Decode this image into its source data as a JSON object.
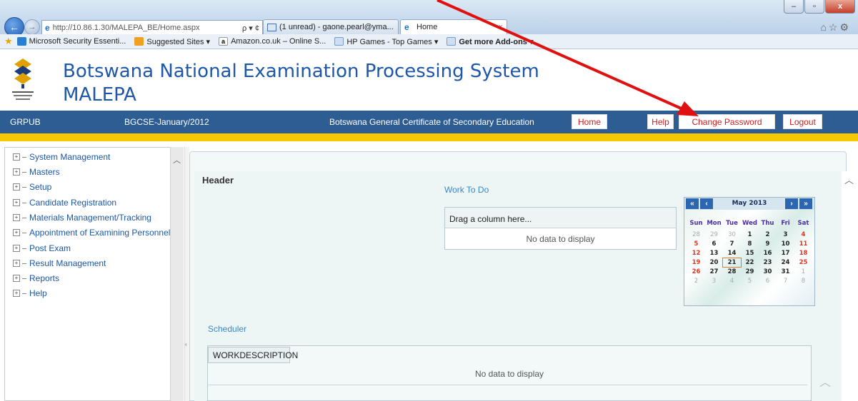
{
  "browser": {
    "url": "http://10.86.1.30/MALEPA_BE/Home.aspx",
    "search_glyph": "ρ ▾ ¢",
    "tabs": [
      {
        "label": "(1 unread) - gaone.pearl@yma..."
      },
      {
        "label": "Home",
        "close": "×"
      }
    ],
    "window_controls": {
      "minimize": "–",
      "maximize": "▫",
      "close": "x"
    },
    "right_icons": "⌂☆⚙",
    "favorites": [
      {
        "label": "Microsoft Security Essenti..."
      },
      {
        "label": "Suggested Sites ▾"
      },
      {
        "label": "Amazon.co.uk – Online S..."
      },
      {
        "label": "HP Games - Top Games ▾"
      },
      {
        "label": "Get more Add-ons ▾"
      }
    ]
  },
  "header": {
    "title_line1": "Botswana National Examination Processing System",
    "title_line2": "MALEPA"
  },
  "topbar": {
    "user": "GRPUB",
    "session": "BGCSE-January/2012",
    "certificate": "Botswana General Certificate of Secondary Education",
    "buttons": {
      "home": "Home",
      "help": "Help",
      "change_password": "Change Password",
      "logout": "Logout"
    }
  },
  "tree": {
    "items": [
      {
        "label": "System Management"
      },
      {
        "label": "Masters"
      },
      {
        "label": "Setup"
      },
      {
        "label": "Candidate Registration"
      },
      {
        "label": "Materials Management/Tracking"
      },
      {
        "label": "Appointment of Examining Personnel"
      },
      {
        "label": "Post Exam"
      },
      {
        "label": "Result Management"
      },
      {
        "label": "Reports"
      },
      {
        "label": "Help"
      }
    ]
  },
  "main": {
    "header_label": "Header",
    "work_to_do": {
      "title": "Work To Do",
      "group_prompt": "Drag a column here...",
      "empty": "No data to display"
    },
    "calendar": {
      "month": "May 2013",
      "nav": {
        "prev_year": "«",
        "prev": "‹",
        "next": "›",
        "next_year": "»"
      },
      "weekdays": [
        "Sun",
        "Mon",
        "Tue",
        "Wed",
        "Thu",
        "Fri",
        "Sat"
      ],
      "weeks": [
        [
          "28",
          "29",
          "30",
          "1",
          "2",
          "3",
          "4"
        ],
        [
          "5",
          "6",
          "7",
          "8",
          "9",
          "10",
          "11"
        ],
        [
          "12",
          "13",
          "14",
          "15",
          "16",
          "17",
          "18"
        ],
        [
          "19",
          "20",
          "21",
          "22",
          "23",
          "24",
          "25"
        ],
        [
          "26",
          "27",
          "28",
          "29",
          "30",
          "31",
          "1"
        ],
        [
          "2",
          "3",
          "4",
          "5",
          "6",
          "7",
          "8"
        ]
      ],
      "selected": "21"
    },
    "scheduler": {
      "title": "Scheduler",
      "column": "WORKDESCRIPTION",
      "empty": "No data to display"
    }
  },
  "colors": {
    "topbar": "#2e5d93",
    "accent_yellow": "#f5c800",
    "button_text": "#d51b1b",
    "arrow": "#e01010"
  }
}
